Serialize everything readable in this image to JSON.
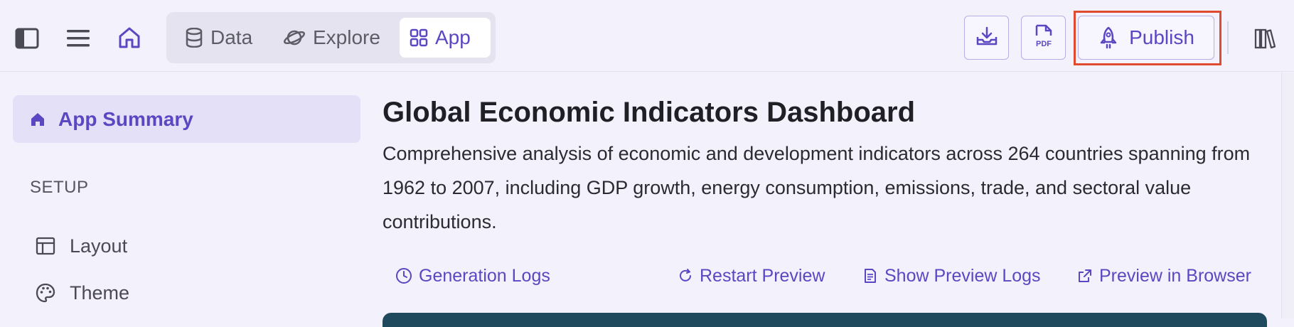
{
  "topbar": {
    "icons": {
      "sidebar_toggle": "sidebar-panel-icon",
      "menu": "hamburger-menu-icon",
      "home": "home-icon",
      "download": "download-tray-icon",
      "pdf": "pdf-file-icon",
      "docs": "books-icon"
    },
    "tabs": [
      {
        "label": "Data",
        "icon": "database-icon",
        "active": false
      },
      {
        "label": "Explore",
        "icon": "planet-icon",
        "active": false
      },
      {
        "label": "App",
        "icon": "grid-icon",
        "active": true
      }
    ],
    "pdf_label": "PDF",
    "publish_label": "Publish"
  },
  "sidebar": {
    "active_item": {
      "label": "App Summary",
      "icon": "home-icon"
    },
    "section_heading": "SETUP",
    "items": [
      {
        "label": "Layout",
        "icon": "layout-icon"
      },
      {
        "label": "Theme",
        "icon": "palette-icon"
      }
    ]
  },
  "main": {
    "title": "Global Economic Indicators Dashboard",
    "description": "Comprehensive analysis of economic and development indicators across 264 countries spanning from 1962 to 2007, including GDP growth, energy consumption, emissions, trade, and sectoral value contributions.",
    "links": {
      "generation_logs": "Generation Logs",
      "restart_preview": "Restart Preview",
      "show_preview_logs": "Show Preview Logs",
      "preview_in_browser": "Preview in Browser"
    }
  },
  "colors": {
    "accent": "#5b47c2",
    "background": "#f3f1fb",
    "highlight": "#e04a2f",
    "preview_header": "#1f4a5e"
  }
}
